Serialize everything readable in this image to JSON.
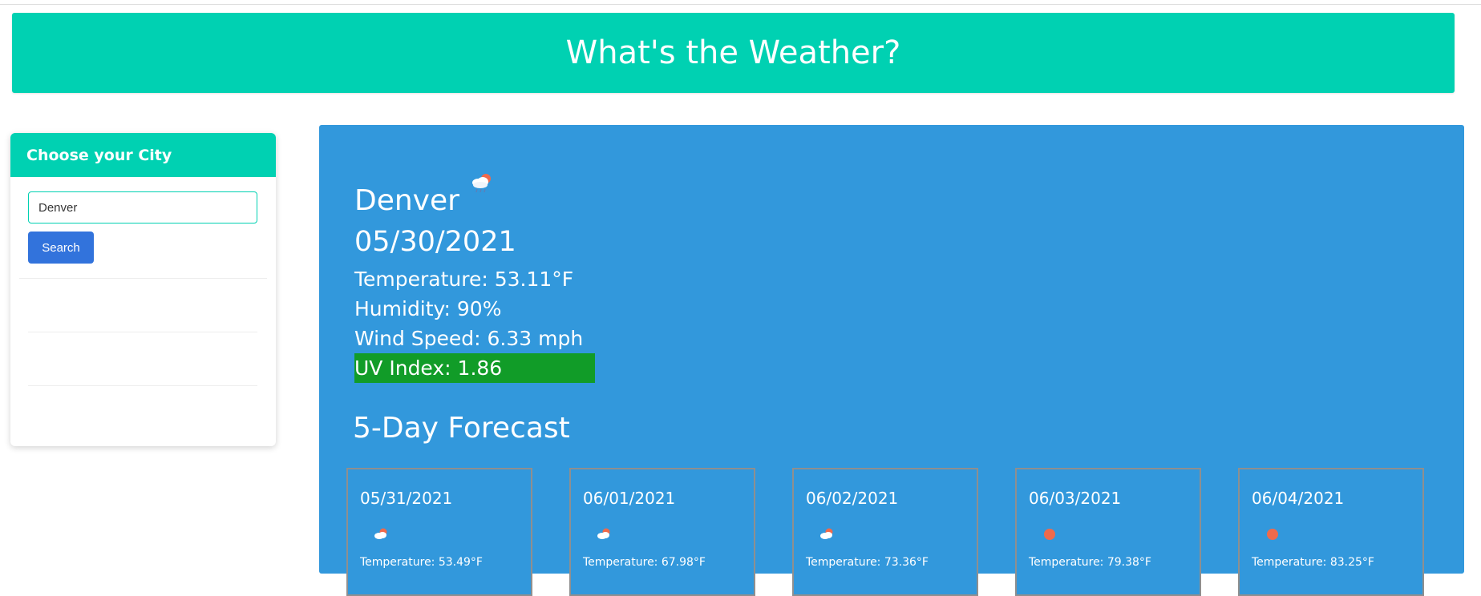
{
  "header": {
    "title": "What's the Weather?"
  },
  "sidebar": {
    "title": "Choose your City",
    "search": {
      "value": "Denver",
      "placeholder": ""
    },
    "search_button_label": "Search"
  },
  "current": {
    "city": "Denver",
    "icon": "cloud-rain-sun-icon",
    "date": "05/30/2021",
    "temperature": "Temperature: 53.11°F",
    "humidity": "Humidity: 90%",
    "wind": "Wind Speed: 6.33 mph",
    "uv": "UV Index: 1.86"
  },
  "forecast": {
    "heading": "5-Day Forecast",
    "days": [
      {
        "date": "05/31/2021",
        "icon": "cloud-sun-icon",
        "temp": "Temperature: 53.49°F"
      },
      {
        "date": "06/01/2021",
        "icon": "cloud-sun-icon",
        "temp": "Temperature: 67.98°F"
      },
      {
        "date": "06/02/2021",
        "icon": "cloud-sun-icon",
        "temp": "Temperature: 73.36°F"
      },
      {
        "date": "06/03/2021",
        "icon": "sun-icon",
        "temp": "Temperature: 79.38°F"
      },
      {
        "date": "06/04/2021",
        "icon": "sun-icon",
        "temp": "Temperature: 83.25°F"
      }
    ]
  },
  "colors": {
    "brand": "#00d1b2",
    "panel": "#3298dc",
    "button": "#3273dc",
    "uv_good": "#119c28"
  }
}
